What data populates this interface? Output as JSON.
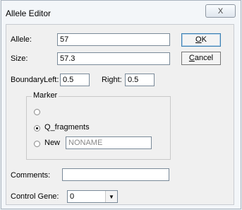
{
  "window": {
    "title": "Allele Editor",
    "close_glyph": "X"
  },
  "fields": {
    "allele": {
      "label": "Allele:",
      "value": "57"
    },
    "size": {
      "label": "Size:",
      "value": "57.3"
    },
    "boundary": {
      "label": "Boundary:",
      "left_label": "Left:",
      "left_value": "0.5",
      "right_label": "Right:",
      "right_value": "0.5"
    }
  },
  "buttons": {
    "ok": {
      "accel": "O",
      "rest": "K"
    },
    "cancel": {
      "accel": "C",
      "rest": "ancel"
    }
  },
  "marker": {
    "title": "Marker",
    "options": [
      {
        "label": "",
        "checked": false
      },
      {
        "label": "Q_fragments",
        "checked": true
      },
      {
        "label": "New",
        "checked": false,
        "value": "NONAME"
      }
    ]
  },
  "comments": {
    "label": "Comments:",
    "value": ""
  },
  "control_gene": {
    "label": "Control Gene:",
    "value": "0",
    "arrow_icon": "▼"
  }
}
